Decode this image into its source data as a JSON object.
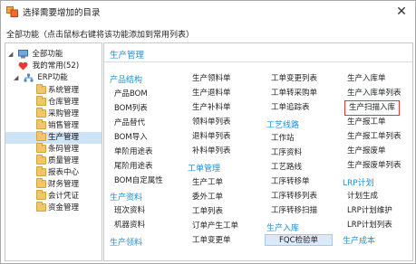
{
  "window": {
    "title": "选择需要增加的目录",
    "close_label": "✕"
  },
  "description": "全部功能（点击鼠标右键将该功能添加到常用列表）",
  "tree": {
    "root_label": "全部功能",
    "favorites_label": "我的常用(52)",
    "erp_label": "ERP功能",
    "items": [
      "系统管理",
      "仓库管理",
      "采购管理",
      "销售管理",
      "生产管理",
      "条码管理",
      "质量管理",
      "报表中心",
      "财务管理",
      "会计凭证",
      "资金管理"
    ]
  },
  "section_title": "生产管理",
  "columns": {
    "col1": {
      "cat1": "产品结构",
      "cat1_items": [
        "产品BOM",
        "BOM列表",
        "产品替代",
        "BOM导入",
        "单阶用途表",
        "尾阶用途表",
        "BOM自定属性"
      ],
      "cat2": "生产资料",
      "cat2_items": [
        "班次资料",
        "机器资料"
      ],
      "cat3": "生产领料"
    },
    "col2": {
      "items": [
        "生产领料单",
        "生产退料单",
        "生产补料单",
        "领料单列表",
        "退料单列表",
        "补料单列表"
      ],
      "cat": "工单管理",
      "cat_items": [
        "生产工单",
        "委外工单",
        "工单列表",
        "订单产生工单",
        "工单变更单"
      ]
    },
    "col3": {
      "items": [
        "工单变更列表",
        "工单转采购单",
        "工单追踪表"
      ],
      "cat1": "工艺线路",
      "cat1_items": [
        "工作站",
        "工序资料",
        "工艺路线",
        "工序转移单",
        "工序转移列表",
        "工序转移扫描"
      ],
      "cat2": "生产入库",
      "cat2_items": [
        "FQC检验单"
      ]
    },
    "col4": {
      "items": [
        "生产入库单",
        "生产入库单列表",
        "生产扫描入库",
        "生产报工单",
        "生产报工单列表",
        "生产报废单",
        "生产报废单列表"
      ],
      "cat1": "LRP计划",
      "cat1_items": [
        "计划生成",
        "LRP计划维护",
        "LRP计划列表"
      ],
      "cat2": "生产成本"
    }
  },
  "colors": {
    "accent": "#1e8fd2",
    "selected_bg": "#cde3f7",
    "highlight_border": "#e0383e"
  }
}
